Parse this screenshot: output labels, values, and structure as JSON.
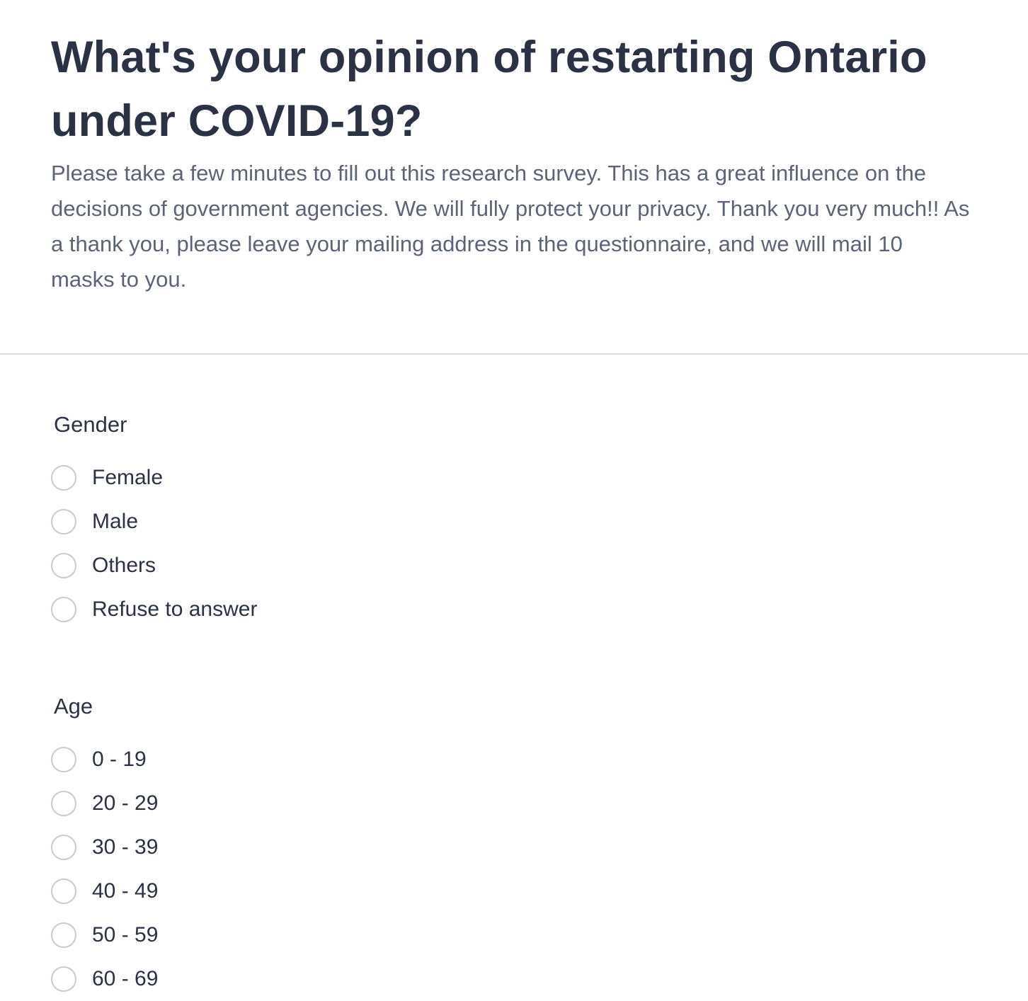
{
  "survey": {
    "title": "What's your opinion of restarting Ontario under COVID-19?",
    "description": "Please take a few minutes to fill out this research survey. This has a great influence on the decisions of government agencies. We will fully protect your privacy. Thank you very much!! As a thank you, please leave your mailing address in the questionnaire, and we will mail 10 masks to you."
  },
  "questions": {
    "gender": {
      "label": "Gender",
      "options": [
        "Female",
        "Male",
        "Others",
        "Refuse to answer"
      ]
    },
    "age": {
      "label": "Age",
      "options": [
        "0 - 19",
        "20 - 29",
        "30 - 39",
        "40 - 49",
        "50 - 59",
        "60 - 69"
      ]
    }
  },
  "colors": {
    "text_primary": "#2b3243",
    "text_secondary": "#5b6477",
    "radio_border": "#c6cbd3",
    "divider": "#dcdfe3"
  }
}
